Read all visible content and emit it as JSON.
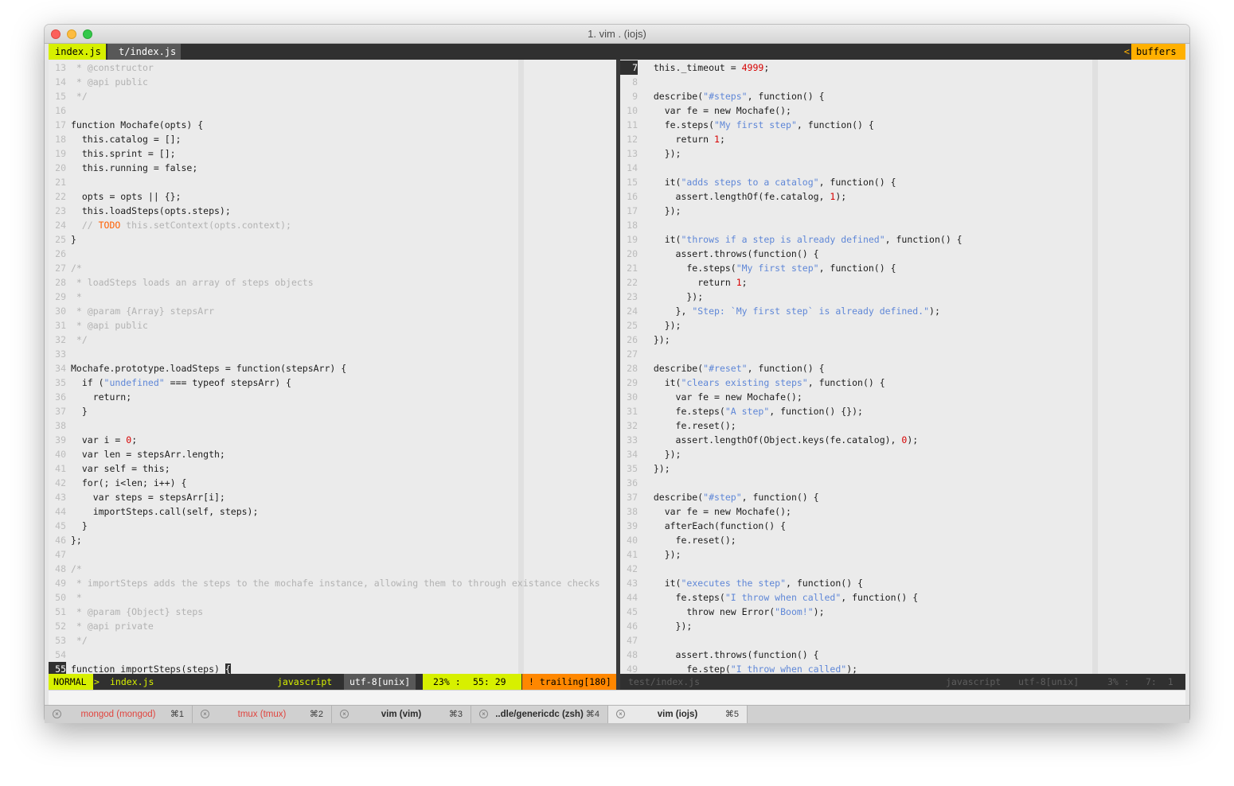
{
  "window": {
    "title": "1. vim . (iojs)"
  },
  "tabline": {
    "active_tab": "index.js",
    "inactive_tab": "t/index.js",
    "right_arrow": "<",
    "buffers_label": "buffers"
  },
  "left_pane": {
    "lines": [
      {
        "n": "13",
        "cls": "c",
        "text": " * @constructor"
      },
      {
        "n": "14",
        "cls": "c",
        "text": " * @api public"
      },
      {
        "n": "15",
        "cls": "c",
        "text": " */"
      },
      {
        "n": "16",
        "text": ""
      },
      {
        "n": "17",
        "html": "function Mochafe(opts) {"
      },
      {
        "n": "18",
        "html": "  this.catalog = [];"
      },
      {
        "n": "19",
        "html": "  this.sprint = [];"
      },
      {
        "n": "20",
        "html": "  this.running = false;"
      },
      {
        "n": "21",
        "text": ""
      },
      {
        "n": "22",
        "html": "  opts = opts || {};"
      },
      {
        "n": "23",
        "html": "  this.loadSteps(opts.steps);"
      },
      {
        "n": "24",
        "parts": [
          [
            "c",
            "  // "
          ],
          [
            "t",
            "TODO"
          ],
          [
            "c",
            " this.setContext(opts.context);"
          ]
        ]
      },
      {
        "n": "25",
        "text": "}"
      },
      {
        "n": "26",
        "text": ""
      },
      {
        "n": "27",
        "cls": "c",
        "text": "/*"
      },
      {
        "n": "28",
        "cls": "c",
        "text": " * loadSteps loads an array of steps objects"
      },
      {
        "n": "29",
        "cls": "c",
        "text": " *"
      },
      {
        "n": "30",
        "cls": "c",
        "text": " * @param {Array} stepsArr"
      },
      {
        "n": "31",
        "cls": "c",
        "text": " * @api public"
      },
      {
        "n": "32",
        "cls": "c",
        "text": " */"
      },
      {
        "n": "33",
        "text": ""
      },
      {
        "n": "34",
        "text": "Mochafe.prototype.loadSteps = function(stepsArr) {"
      },
      {
        "n": "35",
        "parts": [
          [
            "",
            "  if ("
          ],
          [
            "s",
            "\"undefined\""
          ],
          [
            "",
            " === typeof stepsArr) {"
          ]
        ]
      },
      {
        "n": "36",
        "text": "    return;"
      },
      {
        "n": "37",
        "text": "  }"
      },
      {
        "n": "38",
        "text": ""
      },
      {
        "n": "39",
        "parts": [
          [
            "",
            "  var i = "
          ],
          [
            "n",
            "0"
          ],
          [
            "",
            ";"
          ]
        ]
      },
      {
        "n": "40",
        "text": "  var len = stepsArr.length;"
      },
      {
        "n": "41",
        "text": "  var self = this;"
      },
      {
        "n": "42",
        "text": "  for(; i<len; i++) {"
      },
      {
        "n": "43",
        "text": "    var steps = stepsArr[i];"
      },
      {
        "n": "44",
        "text": "    importSteps.call(self, steps);"
      },
      {
        "n": "45",
        "text": "  }"
      },
      {
        "n": "46",
        "text": "};"
      },
      {
        "n": "47",
        "text": ""
      },
      {
        "n": "48",
        "cls": "c",
        "text": "/*"
      },
      {
        "n": "49",
        "cls": "c",
        "text": " * importSteps adds the steps to the mochafe instance, allowing them to through existance checks"
      },
      {
        "n": "50",
        "cls": "c",
        "text": " *"
      },
      {
        "n": "51",
        "cls": "c",
        "text": " * @param {Object} steps"
      },
      {
        "n": "52",
        "cls": "c",
        "text": " * @api private"
      },
      {
        "n": "53",
        "cls": "c",
        "text": " */"
      },
      {
        "n": "54",
        "text": ""
      },
      {
        "n": "55",
        "current": true,
        "parts": [
          [
            "",
            "function importSteps(steps) "
          ],
          [
            "cursor",
            "{"
          ]
        ]
      }
    ]
  },
  "right_pane": {
    "lines": [
      {
        "n": "7",
        "current": true,
        "parts": [
          [
            "",
            "  this._timeout = "
          ],
          [
            "n",
            "4999"
          ],
          [
            "",
            ";"
          ]
        ]
      },
      {
        "n": "8",
        "text": ""
      },
      {
        "n": "9",
        "parts": [
          [
            "",
            "  describe("
          ],
          [
            "s",
            "\"#steps\""
          ],
          [
            "",
            ", function() {"
          ]
        ]
      },
      {
        "n": "10",
        "text": "    var fe = new Mochafe();"
      },
      {
        "n": "11",
        "parts": [
          [
            "",
            "    fe.steps("
          ],
          [
            "s",
            "\"My first step\""
          ],
          [
            "",
            ", function() {"
          ]
        ]
      },
      {
        "n": "12",
        "parts": [
          [
            "",
            "      return "
          ],
          [
            "n",
            "1"
          ],
          [
            "",
            ";"
          ]
        ]
      },
      {
        "n": "13",
        "text": "    });"
      },
      {
        "n": "14",
        "text": ""
      },
      {
        "n": "15",
        "parts": [
          [
            "",
            "    it("
          ],
          [
            "s",
            "\"adds steps to a catalog\""
          ],
          [
            "",
            ", function() {"
          ]
        ]
      },
      {
        "n": "16",
        "parts": [
          [
            "",
            "      assert.lengthOf(fe.catalog, "
          ],
          [
            "n",
            "1"
          ],
          [
            "",
            ");"
          ]
        ]
      },
      {
        "n": "17",
        "text": "    });"
      },
      {
        "n": "18",
        "text": ""
      },
      {
        "n": "19",
        "parts": [
          [
            "",
            "    it("
          ],
          [
            "s",
            "\"throws if a step is already defined\""
          ],
          [
            "",
            ", function() {"
          ]
        ]
      },
      {
        "n": "20",
        "text": "      assert.throws(function() {"
      },
      {
        "n": "21",
        "parts": [
          [
            "",
            "        fe.steps("
          ],
          [
            "s",
            "\"My first step\""
          ],
          [
            "",
            ", function() {"
          ]
        ]
      },
      {
        "n": "22",
        "parts": [
          [
            "",
            "          return "
          ],
          [
            "n",
            "1"
          ],
          [
            "",
            ";"
          ]
        ]
      },
      {
        "n": "23",
        "text": "        });"
      },
      {
        "n": "24",
        "parts": [
          [
            "",
            "      }, "
          ],
          [
            "s",
            "\"Step: `My first step` is already defined.\""
          ],
          [
            "",
            ");"
          ]
        ]
      },
      {
        "n": "25",
        "text": "    });"
      },
      {
        "n": "26",
        "text": "  });"
      },
      {
        "n": "27",
        "text": ""
      },
      {
        "n": "28",
        "parts": [
          [
            "",
            "  describe("
          ],
          [
            "s",
            "\"#reset\""
          ],
          [
            "",
            ", function() {"
          ]
        ]
      },
      {
        "n": "29",
        "parts": [
          [
            "",
            "    it("
          ],
          [
            "s",
            "\"clears existing steps\""
          ],
          [
            "",
            ", function() {"
          ]
        ]
      },
      {
        "n": "30",
        "text": "      var fe = new Mochafe();"
      },
      {
        "n": "31",
        "parts": [
          [
            "",
            "      fe.steps("
          ],
          [
            "s",
            "\"A step\""
          ],
          [
            "",
            ", function() {});"
          ]
        ]
      },
      {
        "n": "32",
        "text": "      fe.reset();"
      },
      {
        "n": "33",
        "parts": [
          [
            "",
            "      assert.lengthOf(Object.keys(fe.catalog), "
          ],
          [
            "n",
            "0"
          ],
          [
            "",
            ");"
          ]
        ]
      },
      {
        "n": "34",
        "text": "    });"
      },
      {
        "n": "35",
        "text": "  });"
      },
      {
        "n": "36",
        "text": ""
      },
      {
        "n": "37",
        "parts": [
          [
            "",
            "  describe("
          ],
          [
            "s",
            "\"#step\""
          ],
          [
            "",
            ", function() {"
          ]
        ]
      },
      {
        "n": "38",
        "text": "    var fe = new Mochafe();"
      },
      {
        "n": "39",
        "text": "    afterEach(function() {"
      },
      {
        "n": "40",
        "text": "      fe.reset();"
      },
      {
        "n": "41",
        "text": "    });"
      },
      {
        "n": "42",
        "text": ""
      },
      {
        "n": "43",
        "parts": [
          [
            "",
            "    it("
          ],
          [
            "s",
            "\"executes the step\""
          ],
          [
            "",
            ", function() {"
          ]
        ]
      },
      {
        "n": "44",
        "parts": [
          [
            "",
            "      fe.steps("
          ],
          [
            "s",
            "\"I throw when called\""
          ],
          [
            "",
            ", function() {"
          ]
        ]
      },
      {
        "n": "45",
        "parts": [
          [
            "",
            "        throw new Error("
          ],
          [
            "s",
            "\"Boom!\""
          ],
          [
            "",
            ");"
          ]
        ]
      },
      {
        "n": "46",
        "text": "      });"
      },
      {
        "n": "47",
        "text": ""
      },
      {
        "n": "48",
        "text": "      assert.throws(function() {"
      },
      {
        "n": "49",
        "parts": [
          [
            "",
            "        fe.step("
          ],
          [
            "s",
            "\"I throw when called\""
          ],
          [
            "",
            ");"
          ]
        ]
      }
    ]
  },
  "statusline_left": {
    "mode": "NORMAL",
    "sep": ">",
    "file": "index.js",
    "filetype": "javascript",
    "encoding": "utf-8[unix]",
    "percent": "23% :",
    "position": "55: 29",
    "warning": "! trailing[180]"
  },
  "statusline_right": {
    "file": "test/index.js",
    "filetype": "javascript",
    "encoding": "utf-8[unix]",
    "percent": "3% :",
    "position": "7:  1"
  },
  "tmux_tabs": [
    {
      "name": "mongod (mongod)",
      "key": "⌘1",
      "alert": true
    },
    {
      "name": "tmux (tmux)",
      "key": "⌘2",
      "alert": true
    },
    {
      "name": "vim (vim)",
      "key": "⌘3",
      "alert": false
    },
    {
      "name": "..dle/genericdc (zsh)",
      "key": "⌘4",
      "alert": false
    },
    {
      "name": "vim (iojs)",
      "key": "⌘5",
      "alert": false,
      "active": true
    }
  ],
  "colors": {
    "tab_active_bg": "#d7f000",
    "buffers_bg": "#ffb000",
    "string": "#5f87d7",
    "number": "#d70000",
    "todo": "#ff5f00",
    "warning_bg": "#ff8700",
    "alert_tab": "#e0443e"
  }
}
